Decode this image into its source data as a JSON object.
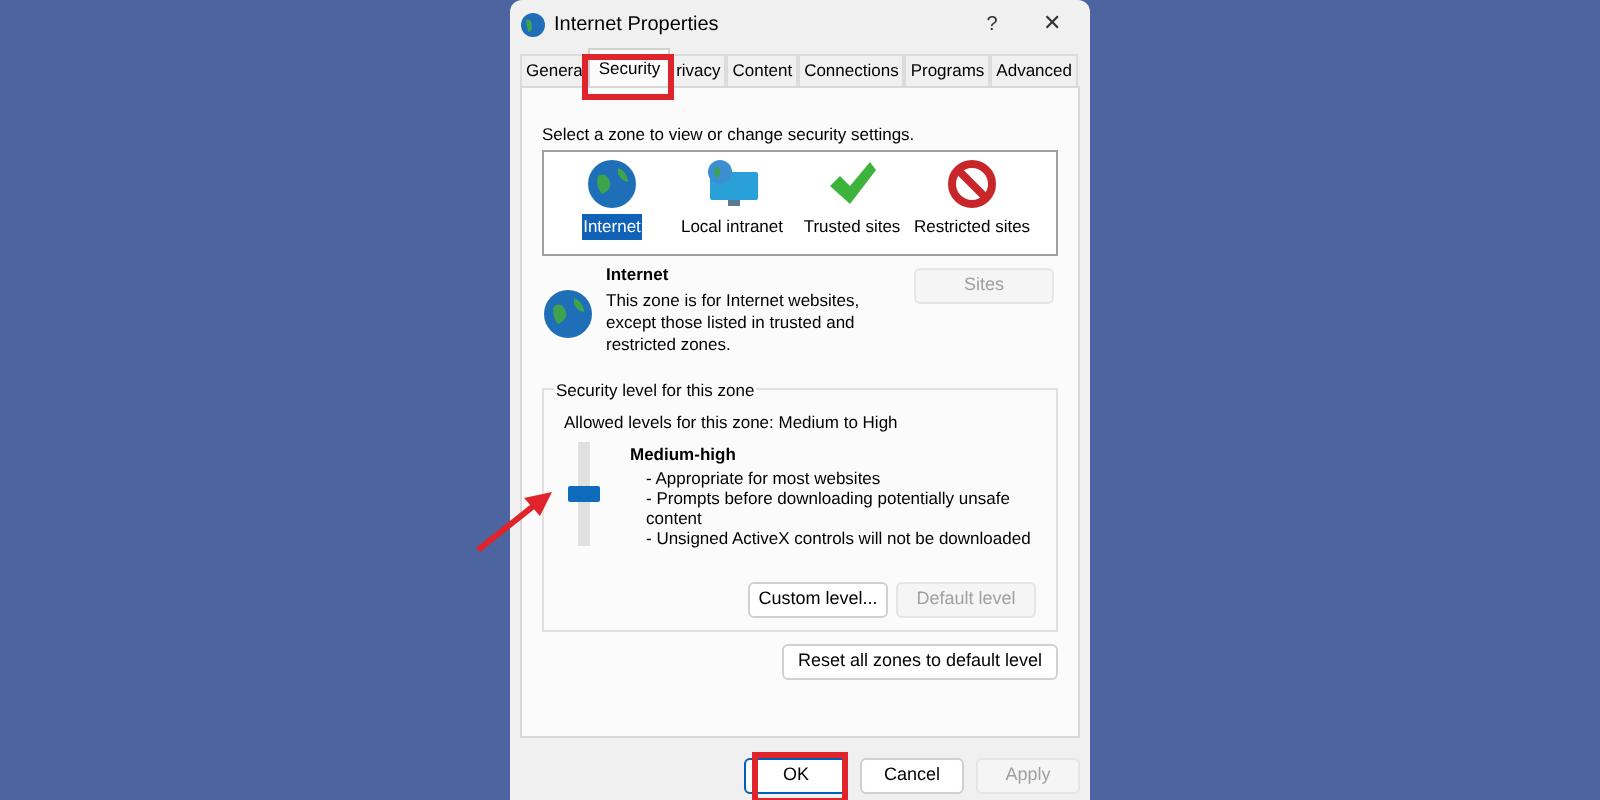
{
  "window": {
    "title": "Internet Properties",
    "help": "?",
    "close": "✕"
  },
  "tabs": [
    {
      "label": "Genera",
      "selected": false
    },
    {
      "label": "Security",
      "selected": true
    },
    {
      "label": "rivacy",
      "selected": false
    },
    {
      "label": "Content",
      "selected": false
    },
    {
      "label": "Connections",
      "selected": false
    },
    {
      "label": "Programs",
      "selected": false
    },
    {
      "label": "Advanced",
      "selected": false
    }
  ],
  "zone_prompt": "Select a zone to view or change security settings.",
  "zones": [
    {
      "kind": "globe",
      "label": "Internet",
      "selected": true
    },
    {
      "kind": "intranet",
      "label": "Local intranet",
      "selected": false
    },
    {
      "kind": "trusted",
      "label": "Trusted sites",
      "selected": false
    },
    {
      "kind": "restricted",
      "label": "Restricted sites",
      "selected": false
    }
  ],
  "zone_info": {
    "title": "Internet",
    "description": "This zone is for Internet websites, except those listed in trusted and restricted zones.",
    "sites_button": {
      "label": "Sites",
      "disabled": true
    }
  },
  "security_level": {
    "legend": "Security level for this zone",
    "allowed": "Allowed levels for this zone: Medium to High",
    "level": 0.5,
    "name": "Medium-high",
    "bullets": [
      "- Appropriate for most websites",
      "- Prompts before downloading potentially unsafe content",
      "- Unsigned ActiveX controls will not be downloaded"
    ],
    "buttons": [
      {
        "label": "Custom level...",
        "disabled": false
      },
      {
        "label": "Default level",
        "disabled": true
      }
    ]
  },
  "reset_button": {
    "label": "Reset all zones to default level",
    "disabled": false
  },
  "footer_buttons": [
    {
      "label": "OK",
      "disabled": false,
      "default": true
    },
    {
      "label": "Cancel",
      "disabled": false,
      "default": false
    },
    {
      "label": "Apply",
      "disabled": true,
      "default": false
    }
  ]
}
